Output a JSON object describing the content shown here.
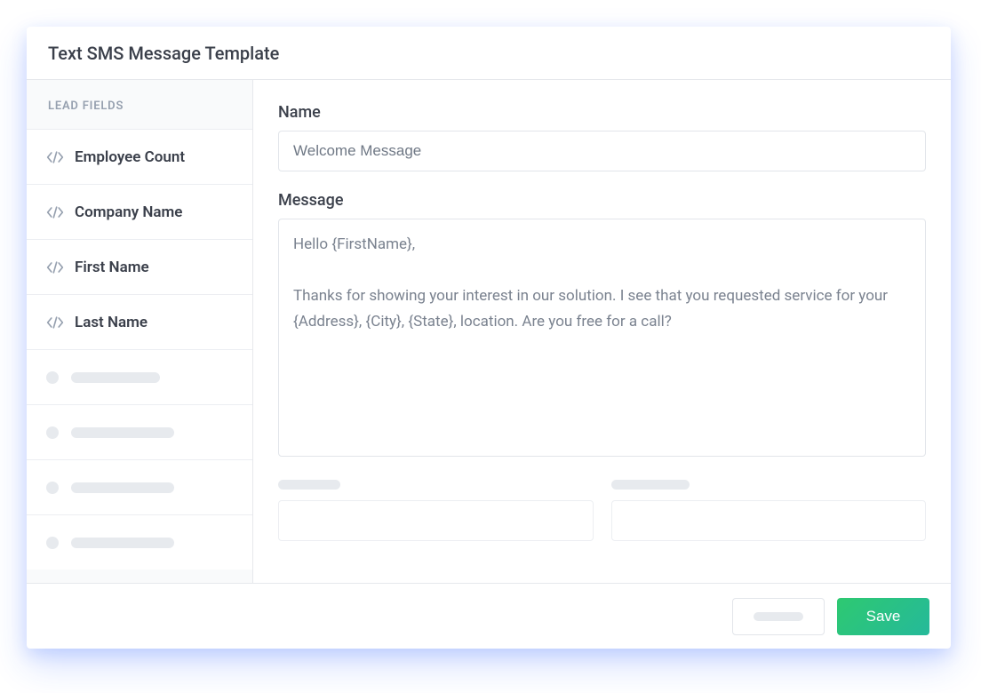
{
  "header": {
    "title": "Text SMS Message Template"
  },
  "sidebar": {
    "section_label": "LEAD FIELDS",
    "fields": [
      {
        "label": "Employee Count"
      },
      {
        "label": "Company Name"
      },
      {
        "label": "First Name"
      },
      {
        "label": "Last Name"
      }
    ]
  },
  "form": {
    "name_label": "Name",
    "name_value": "Welcome Message",
    "message_label": "Message",
    "message_value": "Hello {FirstName},\n\nThanks for showing your interest in our solution. I see that you requested service for your {Address}, {City}, {State}, location. Are you free for a call?"
  },
  "footer": {
    "save_label": "Save"
  },
  "colors": {
    "primary_gradient_from": "#2ec971",
    "primary_gradient_to": "#25b99a",
    "text_dark": "#3a3f4a",
    "text_muted": "#7a828f",
    "border": "#e6e8ec"
  }
}
